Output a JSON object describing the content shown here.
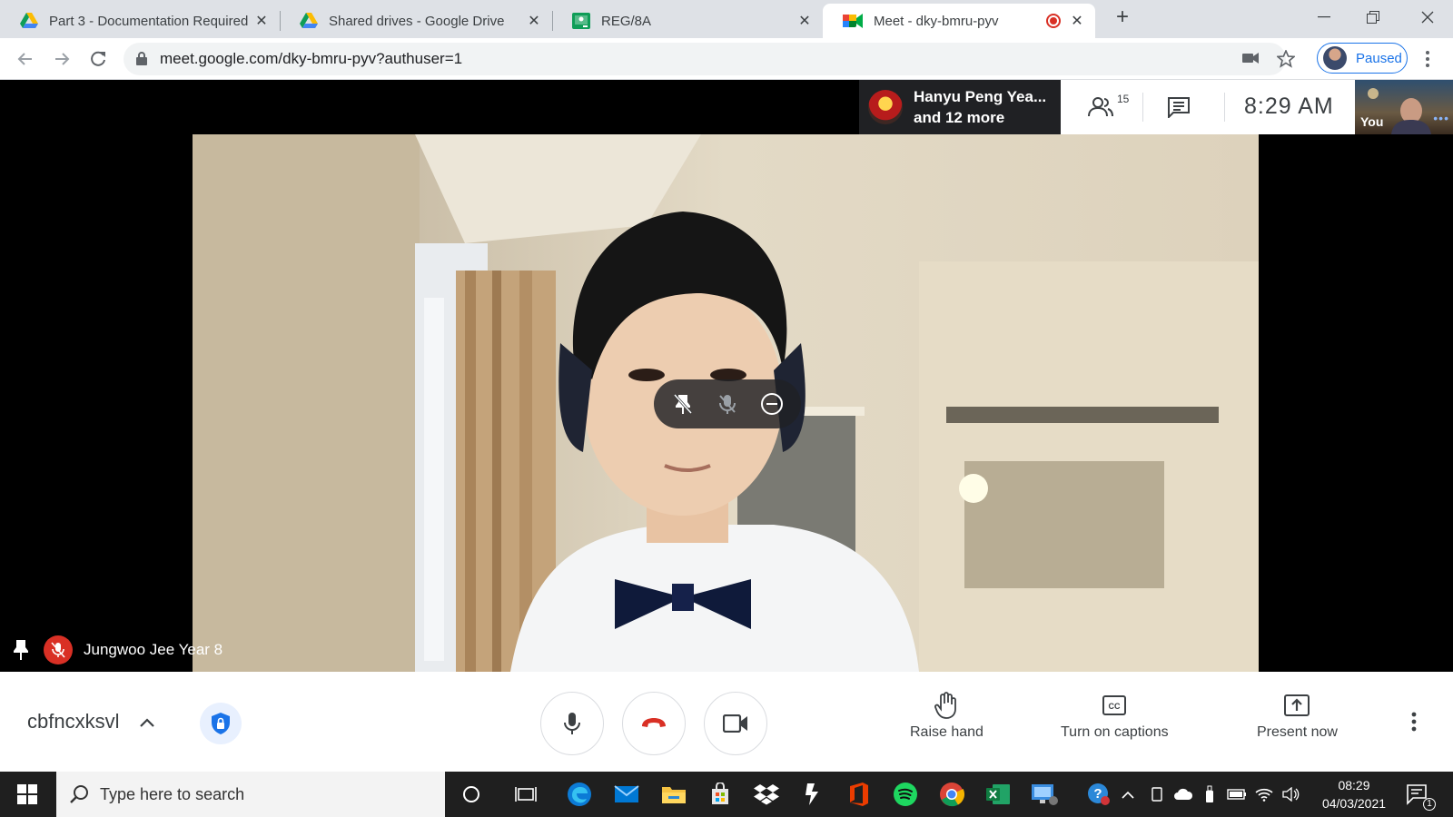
{
  "browser": {
    "tabs": [
      {
        "title": "Part 3 - Documentation Required",
        "icon": "google-drive-icon"
      },
      {
        "title": "Shared drives - Google Drive",
        "icon": "google-drive-icon"
      },
      {
        "title": "REG/8A",
        "icon": "classroom-icon"
      },
      {
        "title": "Meet - dky-bmru-pyv",
        "icon": "google-meet-icon",
        "active": true,
        "recording": true
      }
    ],
    "url": "meet.google.com/dky-bmru-pyv?authuser=1",
    "profile_label": "Paused"
  },
  "meet": {
    "presenting": {
      "line1": "Hanyu Peng Yea...",
      "line2": "and 12 more"
    },
    "participant_count": "15",
    "clock": "8:29  AM",
    "self_label": "You",
    "pinned_participant": "Jungwoo Jee Year 8",
    "meeting_code": "cbfncxksvl",
    "buttons": {
      "raise_hand": "Raise hand",
      "captions": "Turn on captions",
      "present": "Present now"
    }
  },
  "taskbar": {
    "search_placeholder": "Type here to search",
    "time": "08:29",
    "date": "04/03/2021",
    "notification_count": "1"
  },
  "colors": {
    "accent": "#1a73e8",
    "danger": "#d93025",
    "taskbar": "#1f1f1f"
  }
}
